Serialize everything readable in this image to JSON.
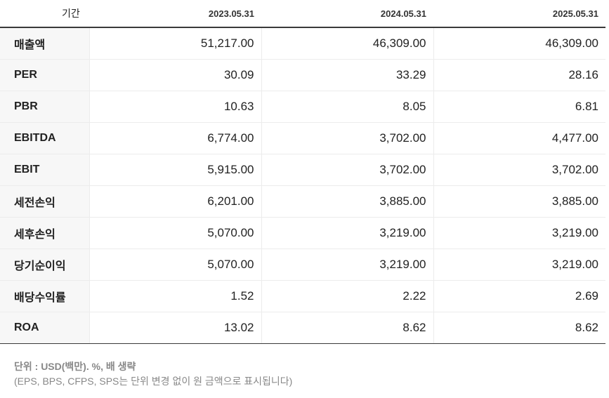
{
  "table": {
    "header": {
      "label": "기간",
      "periods": [
        "2023.05.31",
        "2024.05.31",
        "2025.05.31"
      ]
    },
    "rows": [
      {
        "label": "매출액",
        "values": [
          "51,217.00",
          "46,309.00",
          "46,309.00"
        ]
      },
      {
        "label": "PER",
        "values": [
          "30.09",
          "33.29",
          "28.16"
        ]
      },
      {
        "label": "PBR",
        "values": [
          "10.63",
          "8.05",
          "6.81"
        ]
      },
      {
        "label": "EBITDA",
        "values": [
          "6,774.00",
          "3,702.00",
          "4,477.00"
        ]
      },
      {
        "label": "EBIT",
        "values": [
          "5,915.00",
          "3,702.00",
          "3,702.00"
        ]
      },
      {
        "label": "세전손익",
        "values": [
          "6,201.00",
          "3,885.00",
          "3,885.00"
        ]
      },
      {
        "label": "세후손익",
        "values": [
          "5,070.00",
          "3,219.00",
          "3,219.00"
        ]
      },
      {
        "label": "당기순이익",
        "values": [
          "5,070.00",
          "3,219.00",
          "3,219.00"
        ]
      },
      {
        "label": "배당수익률",
        "values": [
          "1.52",
          "2.22",
          "2.69"
        ]
      },
      {
        "label": "ROA",
        "values": [
          "13.02",
          "8.62",
          "8.62"
        ]
      }
    ]
  },
  "notes": {
    "unit": "단위 : USD(백만). %, 배 생략",
    "disclaimer": "(EPS, BPS, CFPS, SPS는 단위 변경 없이 원 금액으로 표시됩니다)"
  }
}
